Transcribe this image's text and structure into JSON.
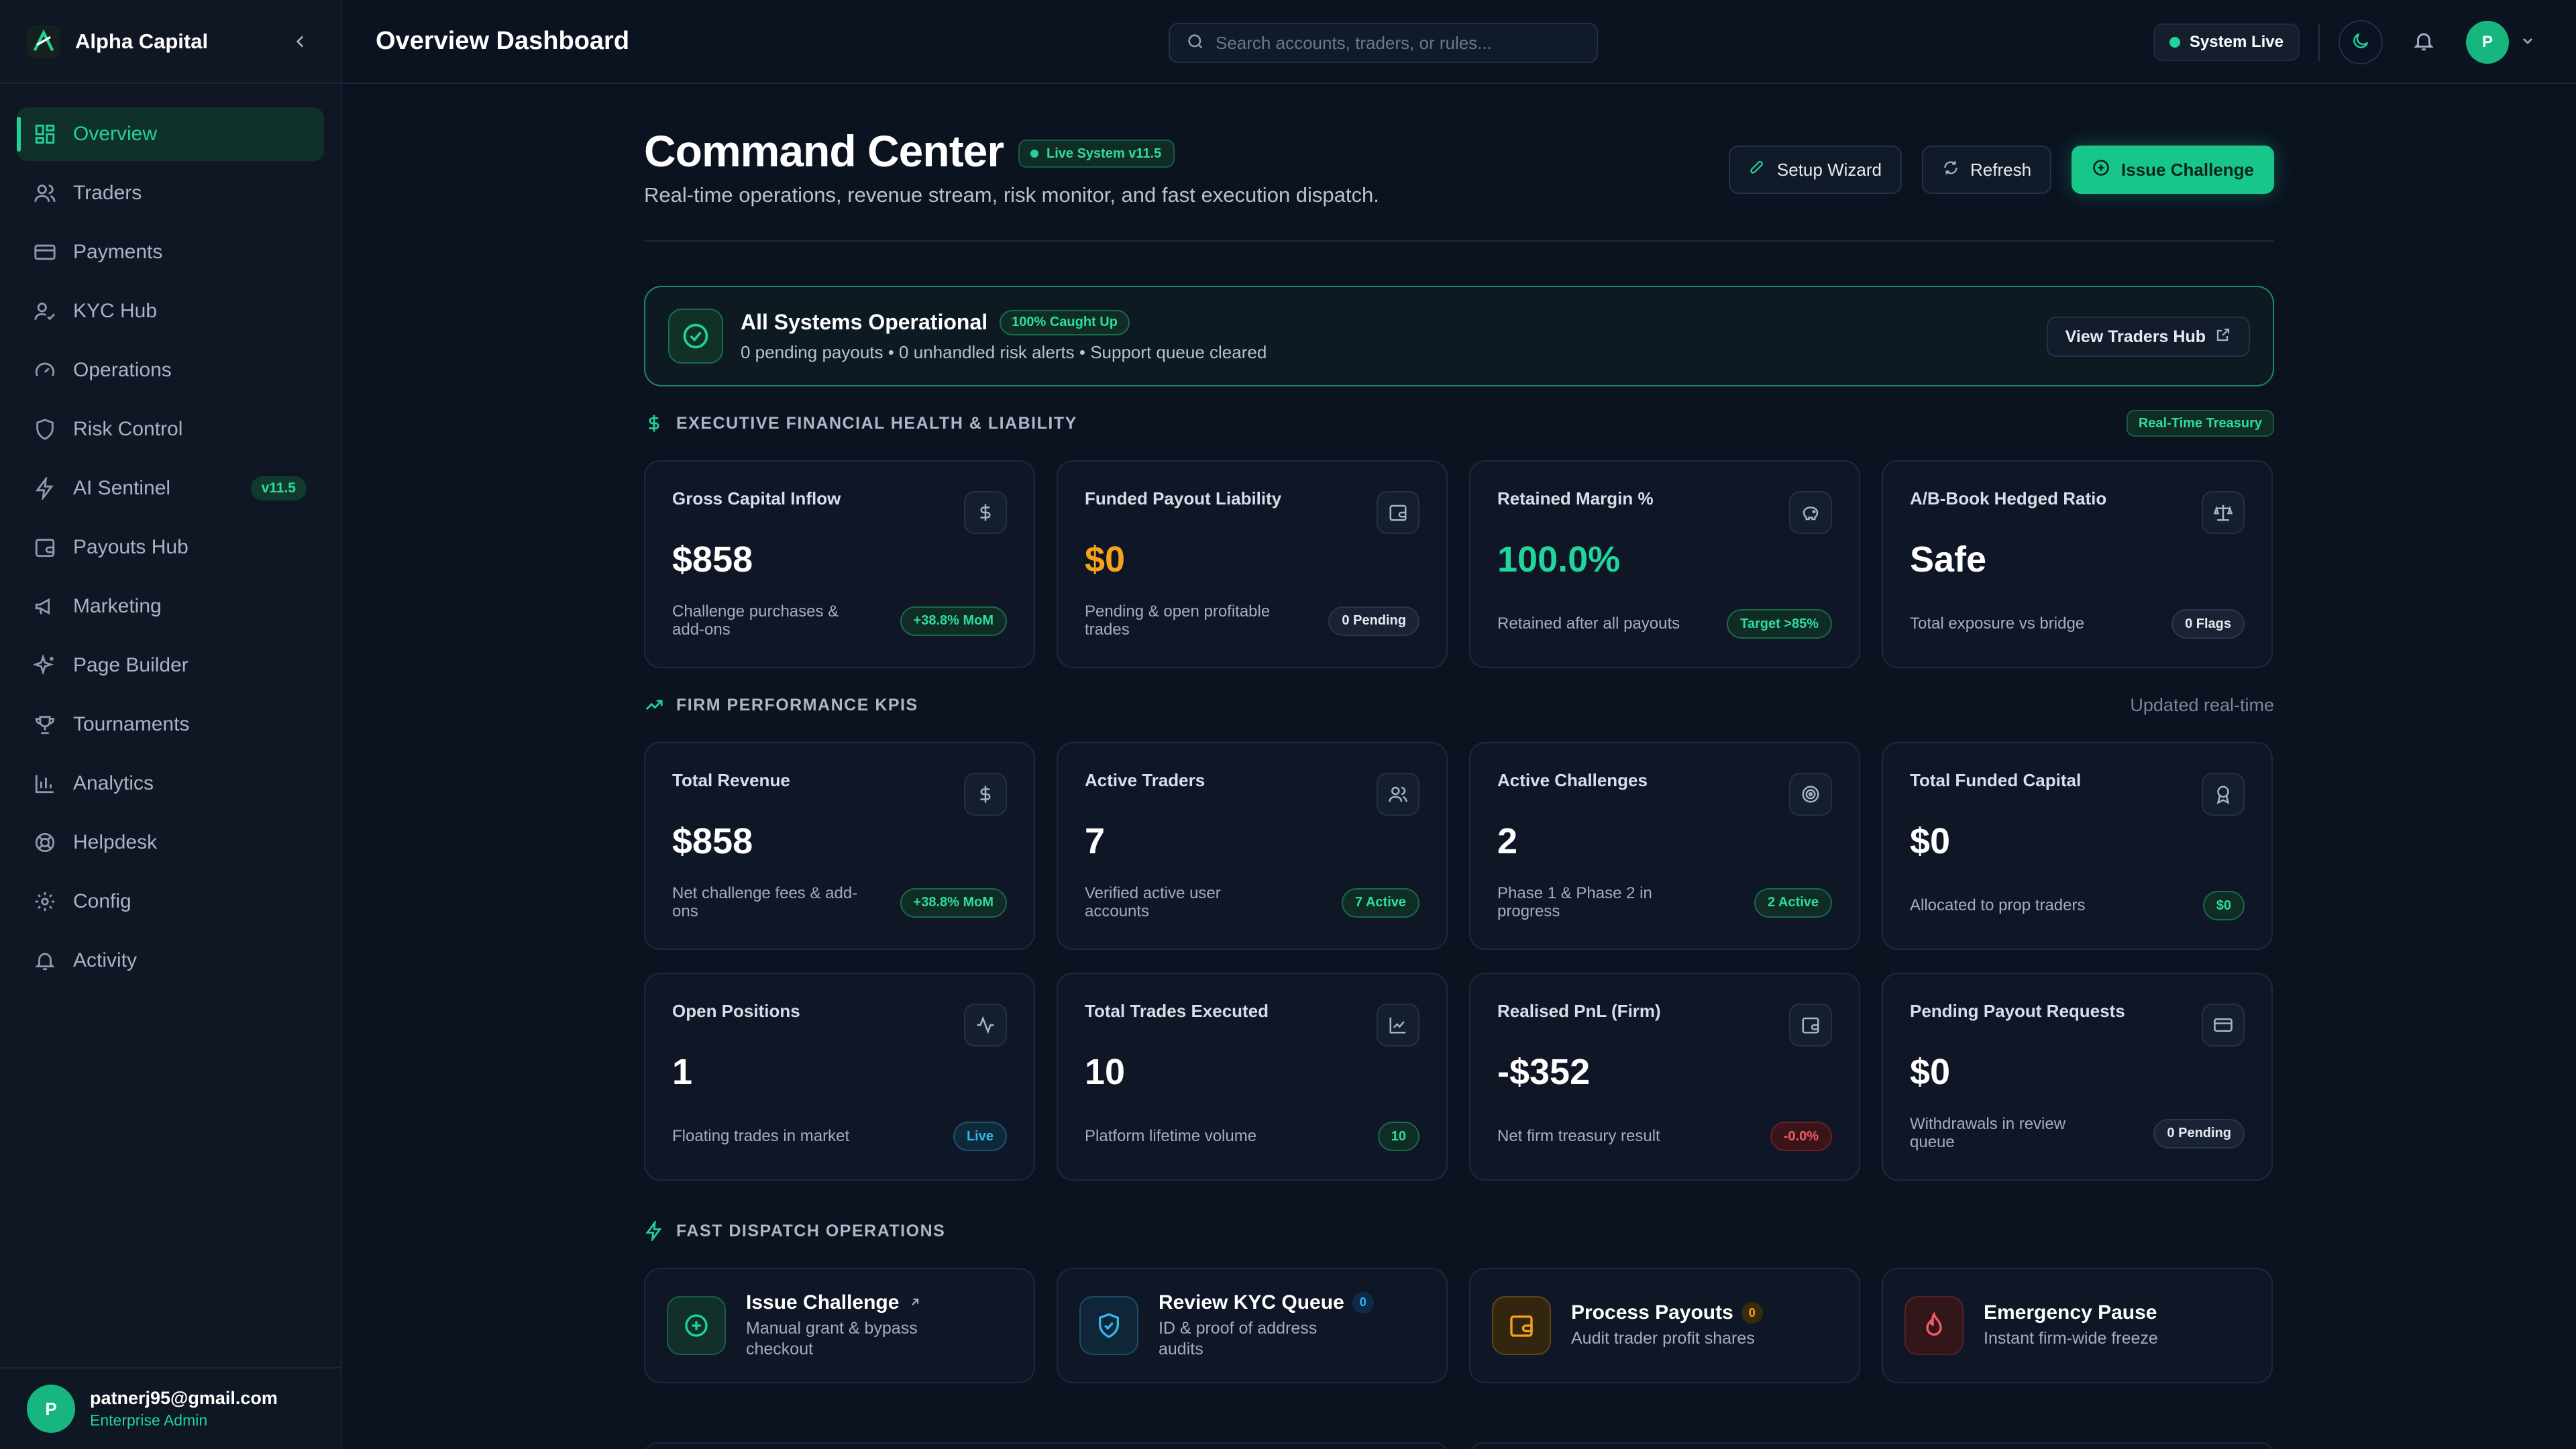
{
  "brand": {
    "name": "Alpha Capital"
  },
  "sidebar": {
    "items": [
      {
        "label": "Overview",
        "icon": "grid-icon",
        "active": true
      },
      {
        "label": "Traders",
        "icon": "users-icon"
      },
      {
        "label": "Payments",
        "icon": "credit-card-icon"
      },
      {
        "label": "KYC Hub",
        "icon": "user-check-icon"
      },
      {
        "label": "Operations",
        "icon": "gauge-icon"
      },
      {
        "label": "Risk Control",
        "icon": "shield-icon"
      },
      {
        "label": "AI Sentinel",
        "icon": "lightning-icon",
        "badge": "v11.5"
      },
      {
        "label": "Payouts Hub",
        "icon": "wallet-icon"
      },
      {
        "label": "Marketing",
        "icon": "megaphone-icon"
      },
      {
        "label": "Page Builder",
        "icon": "sparkles-icon"
      },
      {
        "label": "Tournaments",
        "icon": "trophy-icon"
      },
      {
        "label": "Analytics",
        "icon": "bar-chart-icon"
      },
      {
        "label": "Helpdesk",
        "icon": "lifebuoy-icon"
      },
      {
        "label": "Config",
        "icon": "gear-icon"
      },
      {
        "label": "Activity",
        "icon": "bell-icon"
      }
    ],
    "user": {
      "initial": "P",
      "email": "patnerj95@gmail.com",
      "role": "Enterprise Admin"
    }
  },
  "topbar": {
    "title": "Overview Dashboard",
    "search_placeholder": "Search accounts, traders, or rules...",
    "status": "System Live",
    "avatar_initial": "P"
  },
  "header": {
    "title": "Command Center",
    "version_badge": "Live System v11.5",
    "subtitle": "Real-time operations, revenue stream, risk monitor, and fast execution dispatch.",
    "actions": {
      "setup": "Setup Wizard",
      "refresh": "Refresh",
      "issue": "Issue Challenge"
    }
  },
  "banner": {
    "title": "All Systems Operational",
    "badge": "100% Caught Up",
    "subtitle": "0 pending payouts • 0 unhandled risk alerts • Support queue cleared",
    "button": "View Traders Hub"
  },
  "financial": {
    "title": "EXECUTIVE FINANCIAL HEALTH & LIABILITY",
    "badge": "Real-Time Treasury",
    "cards": [
      {
        "label": "Gross Capital Inflow",
        "value": "$858",
        "desc": "Challenge purchases & add-ons",
        "pill": "+38.8% MoM"
      },
      {
        "label": "Funded Payout Liability",
        "value": "$0",
        "desc": "Pending & open profitable trades",
        "pill": "0 Pending"
      },
      {
        "label": "Retained Margin %",
        "value": "100.0%",
        "desc": "Retained after all payouts",
        "pill": "Target >85%"
      },
      {
        "label": "A/B-Book Hedged Ratio",
        "value": "Safe",
        "desc": "Total exposure vs bridge",
        "pill": "0 Flags"
      }
    ]
  },
  "kpis": {
    "title": "FIRM PERFORMANCE KPIS",
    "note": "Updated real-time",
    "cards": [
      {
        "label": "Total Revenue",
        "value": "$858",
        "desc": "Net challenge fees & add-ons",
        "pill": "+38.8% MoM"
      },
      {
        "label": "Active Traders",
        "value": "7",
        "desc": "Verified active user accounts",
        "pill": "7 Active"
      },
      {
        "label": "Active Challenges",
        "value": "2",
        "desc": "Phase 1 & Phase 2 in progress",
        "pill": "2 Active"
      },
      {
        "label": "Total Funded Capital",
        "value": "$0",
        "desc": "Allocated to prop traders",
        "pill": "$0"
      },
      {
        "label": "Open Positions",
        "value": "1",
        "desc": "Floating trades in market",
        "pill": "Live"
      },
      {
        "label": "Total Trades Executed",
        "value": "10",
        "desc": "Platform lifetime volume",
        "pill": "10"
      },
      {
        "label": "Realised PnL (Firm)",
        "value": "-$352",
        "desc": "Net firm treasury result",
        "pill": "-0.0%"
      },
      {
        "label": "Pending Payout Requests",
        "value": "$0",
        "desc": "Withdrawals in review queue",
        "pill": "0 Pending"
      }
    ]
  },
  "dispatch": {
    "title": "FAST DISPATCH OPERATIONS",
    "items": [
      {
        "title": "Issue Challenge",
        "sub": "Manual grant & bypass checkout"
      },
      {
        "title": "Review KYC Queue",
        "sub": "ID & proof of address audits",
        "count": "0"
      },
      {
        "title": "Process Payouts",
        "sub": "Audit trader profit shares",
        "count": "0"
      },
      {
        "title": "Emergency Pause",
        "sub": "Instant firm-wide freeze"
      }
    ]
  },
  "colors": {
    "accent": "#1fd39a",
    "warning": "#f7a21b",
    "danger": "#f25c66",
    "info": "#35b6f0",
    "background": "#0b1220"
  }
}
